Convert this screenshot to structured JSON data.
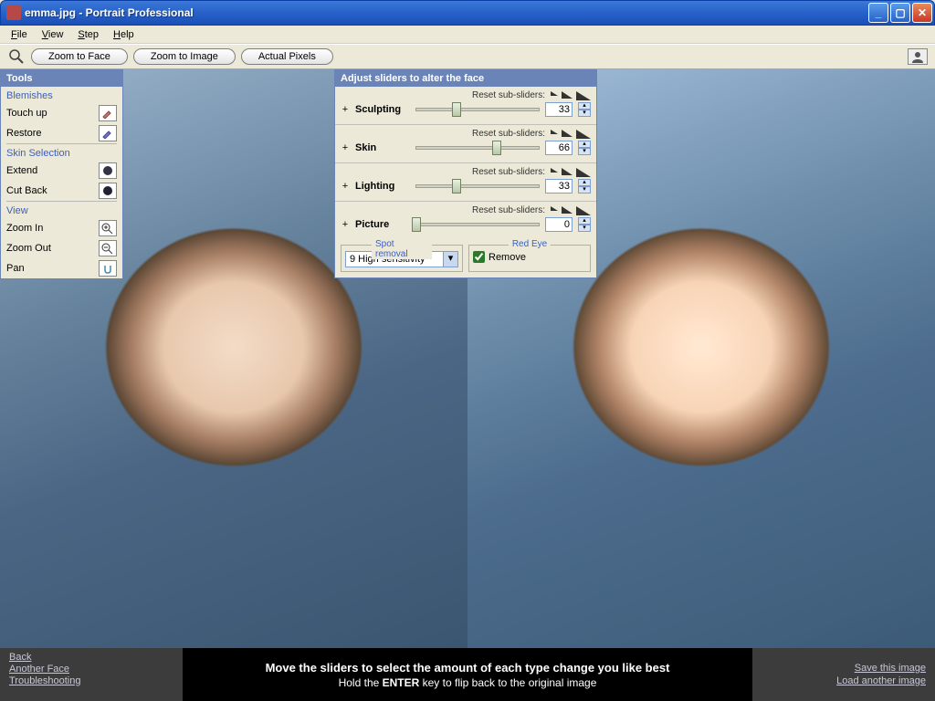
{
  "title": "emma.jpg - Portrait Professional",
  "menu": {
    "file": "File",
    "view": "View",
    "step": "Step",
    "help": "Help"
  },
  "toolbar": {
    "zoom_face": "Zoom to Face",
    "zoom_image": "Zoom to Image",
    "actual_pixels": "Actual Pixels"
  },
  "tools": {
    "title": "Tools",
    "blemishes": "Blemishes",
    "touch_up": "Touch up",
    "restore": "Restore",
    "skin_selection": "Skin Selection",
    "extend": "Extend",
    "cut_back": "Cut Back",
    "view": "View",
    "zoom_in": "Zoom In",
    "zoom_out": "Zoom Out",
    "pan": "Pan"
  },
  "sliders": {
    "title": "Adjust sliders to alter the face",
    "reset_label": "Reset sub-sliders:",
    "items": [
      {
        "label": "Sculpting",
        "value": "33",
        "pct": 33
      },
      {
        "label": "Skin",
        "value": "66",
        "pct": 66
      },
      {
        "label": "Lighting",
        "value": "33",
        "pct": 33
      },
      {
        "label": "Picture",
        "value": "0",
        "pct": 0
      }
    ],
    "spot_removal_legend": "Spot removal",
    "spot_removal_value": "9 High sensitivity",
    "red_eye_legend": "Red Eye",
    "red_eye_label": "Remove"
  },
  "footer": {
    "back": "Back",
    "another_face": "Another Face",
    "troubleshooting": "Troubleshooting",
    "line1": "Move the sliders to select the amount of each type change you like best",
    "line2a": "Hold the ",
    "line2b": "ENTER",
    "line2c": " key to flip back to the original image",
    "save": "Save this image",
    "load": "Load another image"
  }
}
